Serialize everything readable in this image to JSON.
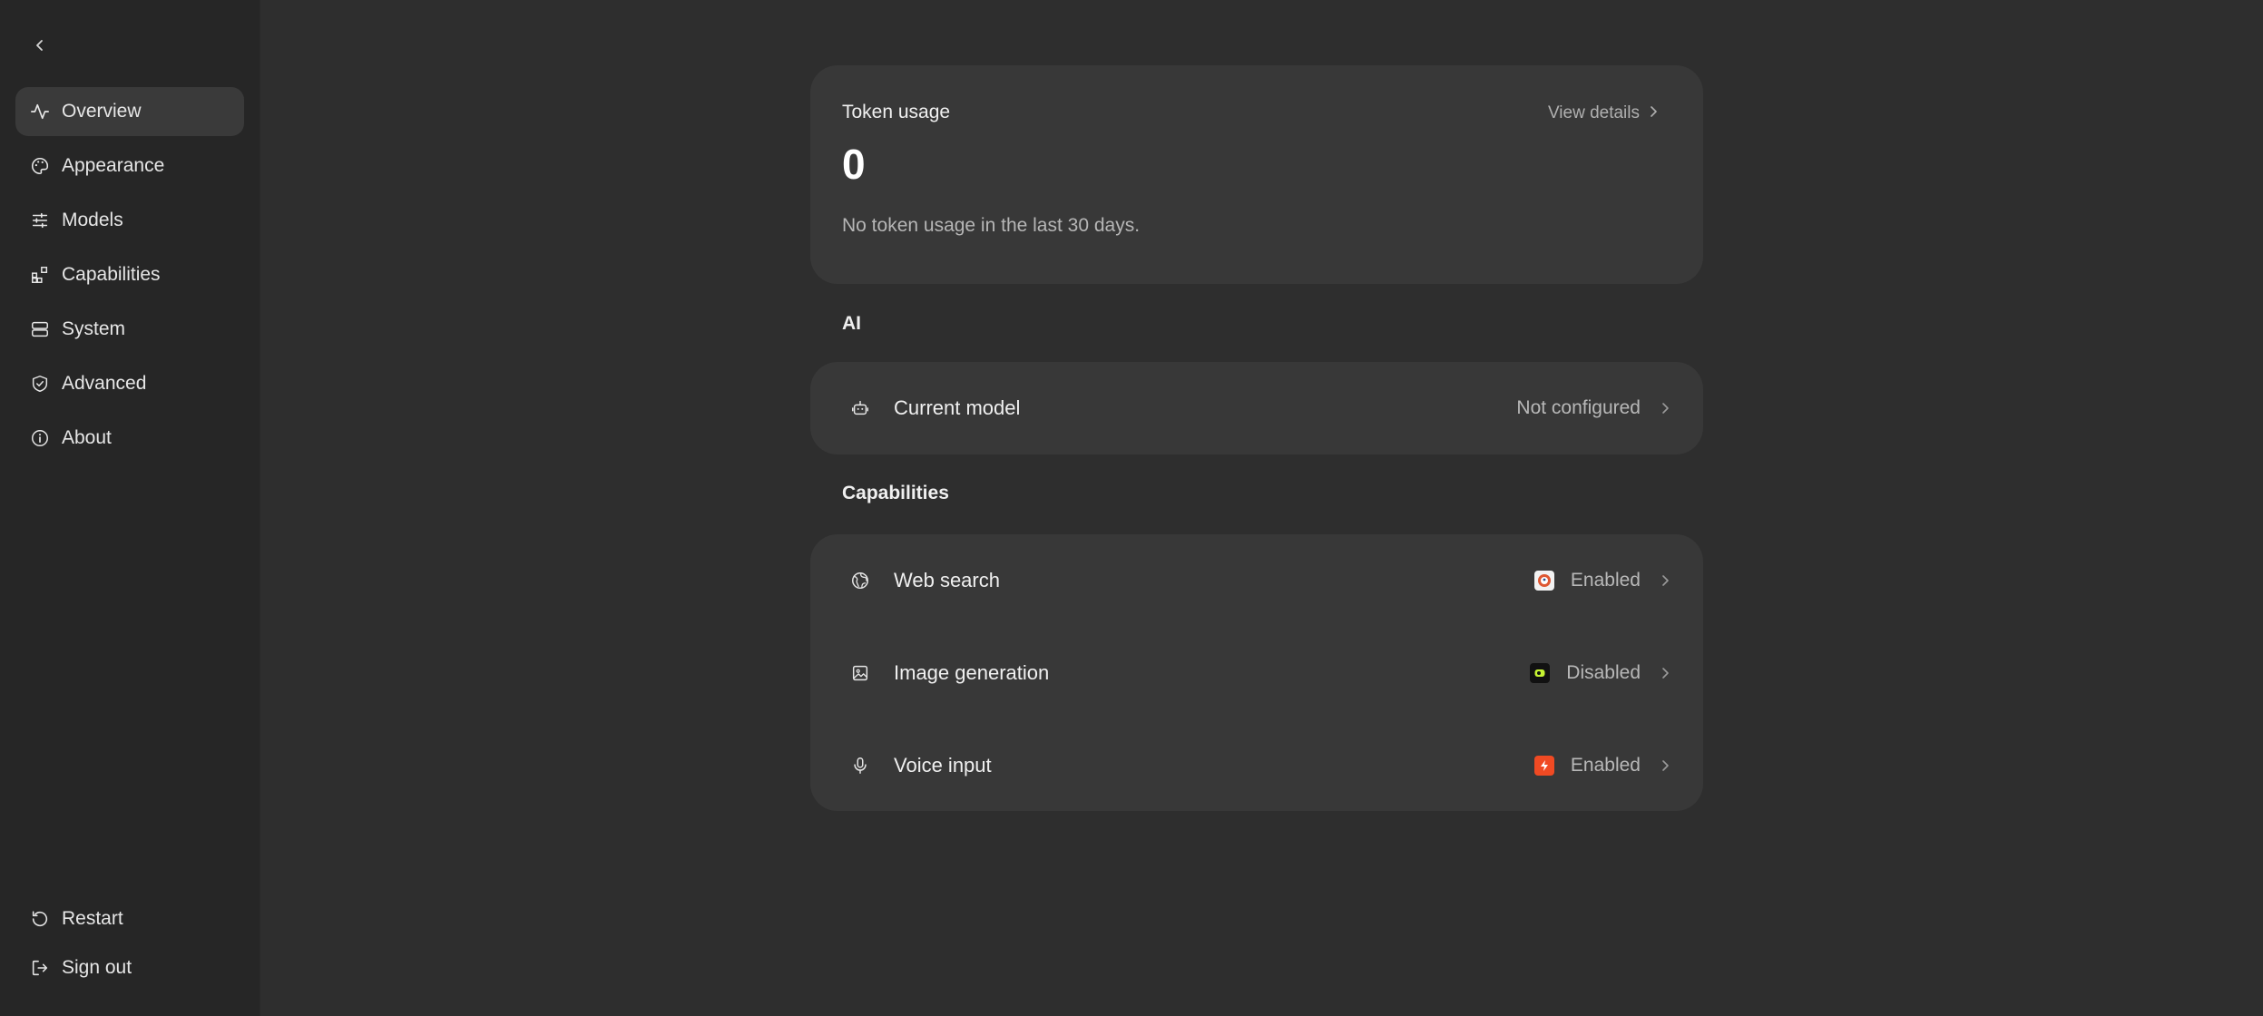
{
  "sidebar": {
    "items": [
      {
        "label": "Overview",
        "icon": "activity-icon",
        "active": true
      },
      {
        "label": "Appearance",
        "icon": "palette-icon",
        "active": false
      },
      {
        "label": "Models",
        "icon": "sliders-icon",
        "active": false
      },
      {
        "label": "Capabilities",
        "icon": "blocks-icon",
        "active": false
      },
      {
        "label": "System",
        "icon": "server-icon",
        "active": false
      },
      {
        "label": "Advanced",
        "icon": "shield-check-icon",
        "active": false
      },
      {
        "label": "About",
        "icon": "info-icon",
        "active": false
      }
    ],
    "bottom": [
      {
        "label": "Restart",
        "icon": "restart-icon"
      },
      {
        "label": "Sign out",
        "icon": "sign-out-icon"
      }
    ]
  },
  "token_usage": {
    "title": "Token usage",
    "value": "0",
    "description": "No token usage in the last 30 days.",
    "view_details": "View details"
  },
  "ai_section": {
    "title": "AI",
    "current_model": {
      "label": "Current model",
      "status": "Not configured",
      "icon": "robot-icon"
    }
  },
  "capabilities_section": {
    "title": "Capabilities",
    "items": [
      {
        "label": "Web search",
        "status": "Enabled",
        "icon": "globe-icon",
        "badge_color": "#de5833"
      },
      {
        "label": "Image generation",
        "status": "Disabled",
        "icon": "image-icon",
        "badge_color": "#c6f432"
      },
      {
        "label": "Voice input",
        "status": "Enabled",
        "icon": "mic-icon",
        "badge_color": "#f04a23"
      }
    ]
  }
}
